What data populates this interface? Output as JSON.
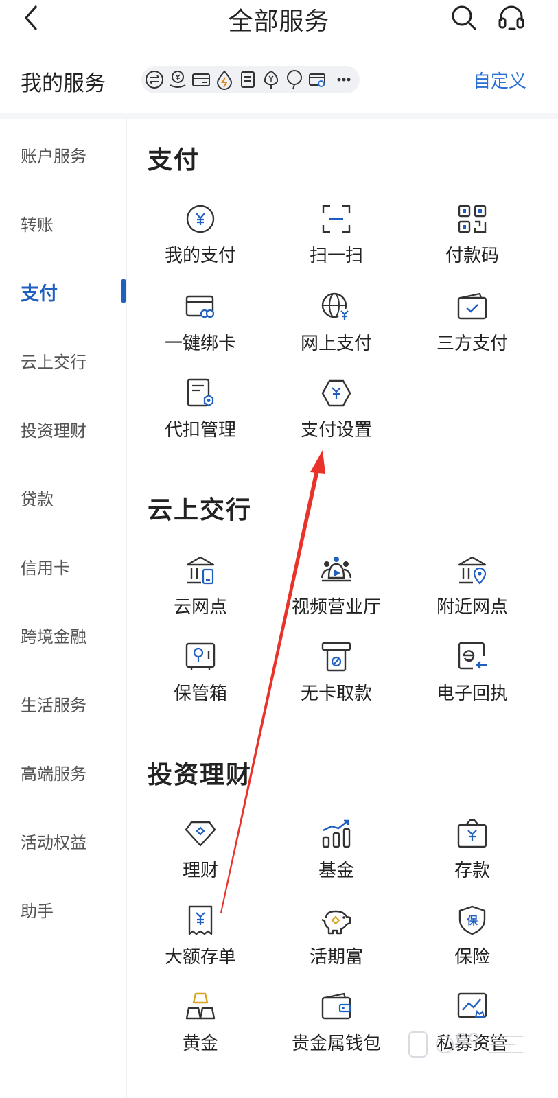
{
  "header": {
    "title": "全部服务",
    "back_icon": "chevron-left-icon",
    "search_icon": "search-icon",
    "support_icon": "headset-icon"
  },
  "my_services": {
    "label": "我的服务",
    "customize": "自定义"
  },
  "sidebar": {
    "items": [
      {
        "label": "账户服务"
      },
      {
        "label": "转账"
      },
      {
        "label": "支付"
      },
      {
        "label": "云上交行"
      },
      {
        "label": "投资理财"
      },
      {
        "label": "贷款"
      },
      {
        "label": "信用卡"
      },
      {
        "label": "跨境金融"
      },
      {
        "label": "生活服务"
      },
      {
        "label": "高端服务"
      },
      {
        "label": "活动权益"
      },
      {
        "label": "助手"
      }
    ],
    "active": "支付"
  },
  "sections": [
    {
      "title": "支付",
      "items": [
        {
          "label": "我的支付",
          "icon": "yuan-circle-icon"
        },
        {
          "label": "扫一扫",
          "icon": "scan-icon"
        },
        {
          "label": "付款码",
          "icon": "qr-code-icon"
        },
        {
          "label": "一键绑卡",
          "icon": "card-link-icon"
        },
        {
          "label": "网上支付",
          "icon": "globe-yuan-icon"
        },
        {
          "label": "三方支付",
          "icon": "wallet-check-icon"
        },
        {
          "label": "代扣管理",
          "icon": "document-gear-icon"
        },
        {
          "label": "支付设置",
          "icon": "hexagon-yuan-icon"
        }
      ]
    },
    {
      "title": "云上交行",
      "items": [
        {
          "label": "云网点",
          "icon": "bank-branch-icon"
        },
        {
          "label": "视频营业厅",
          "icon": "video-hall-icon"
        },
        {
          "label": "附近网点",
          "icon": "bank-location-icon"
        },
        {
          "label": "保管箱",
          "icon": "safe-box-icon"
        },
        {
          "label": "无卡取款",
          "icon": "atm-withdraw-icon"
        },
        {
          "label": "电子回执",
          "icon": "e-receipt-icon"
        }
      ]
    },
    {
      "title": "投资理财",
      "items": [
        {
          "label": "理财",
          "icon": "diamond-tag-icon"
        },
        {
          "label": "基金",
          "icon": "bar-trend-icon"
        },
        {
          "label": "存款",
          "icon": "deposit-box-icon"
        },
        {
          "label": "大额存单",
          "icon": "receipt-yuan-icon"
        },
        {
          "label": "活期富",
          "icon": "piggy-bank-icon"
        },
        {
          "label": "保险",
          "icon": "shield-icon"
        },
        {
          "label": "黄金",
          "icon": "gold-bars-icon"
        },
        {
          "label": "贵金属钱包",
          "icon": "wallet-icon"
        },
        {
          "label": "私募资管",
          "icon": "chart-crown-icon"
        }
      ]
    }
  ],
  "colors": {
    "accent": "#1f5fbf",
    "icon_stroke": "#333333",
    "annotation_arrow": "#e8322a",
    "gold": "#d9a520"
  }
}
